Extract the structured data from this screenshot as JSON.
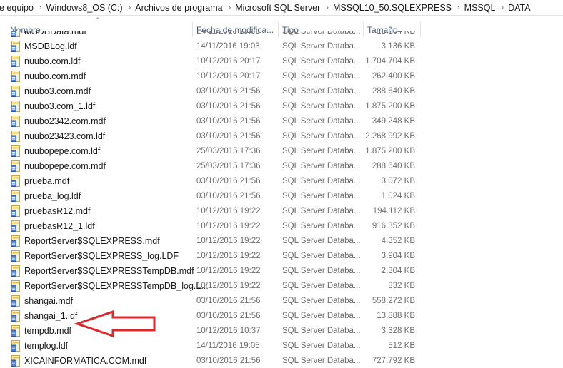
{
  "breadcrumb": [
    "e equipo",
    "Windows8_OS (C:)",
    "Archivos de programa",
    "Microsoft SQL Server",
    "MSSQL10_50.SQLEXPRESS",
    "MSSQL",
    "DATA"
  ],
  "columns": {
    "name": "Nombre",
    "date": "Fecha de modifica...",
    "type": "Tipo",
    "size": "Tamaño"
  },
  "files": [
    {
      "name": "MSDBData.mdf",
      "date": "14/11/2016 19:03",
      "type": "SQL Server Databa...",
      "size": "13.104 KB"
    },
    {
      "name": "MSDBLog.ldf",
      "date": "14/11/2016 19:03",
      "type": "SQL Server Databa...",
      "size": "3.136 KB"
    },
    {
      "name": "nuubo.com.ldf",
      "date": "10/12/2016 20:17",
      "type": "SQL Server Databa...",
      "size": "1.704.704 KB"
    },
    {
      "name": "nuubo.com.mdf",
      "date": "10/12/2016 20:17",
      "type": "SQL Server Databa...",
      "size": "262.400 KB"
    },
    {
      "name": "nuubo3.com.mdf",
      "date": "03/10/2016 21:56",
      "type": "SQL Server Databa...",
      "size": "288.640 KB"
    },
    {
      "name": "nuubo3.com_1.ldf",
      "date": "03/10/2016 21:56",
      "type": "SQL Server Databa...",
      "size": "1.875.200 KB"
    },
    {
      "name": "nuubo2342.com.mdf",
      "date": "03/10/2016 21:56",
      "type": "SQL Server Databa...",
      "size": "349.248 KB"
    },
    {
      "name": "nuubo23423.com.ldf",
      "date": "03/10/2016 21:56",
      "type": "SQL Server Databa...",
      "size": "2.268.992 KB"
    },
    {
      "name": "nuubopepe.com.ldf",
      "date": "25/03/2015 17:36",
      "type": "SQL Server Databa...",
      "size": "1.875.200 KB"
    },
    {
      "name": "nuubopepe.com.mdf",
      "date": "25/03/2015 17:36",
      "type": "SQL Server Databa...",
      "size": "288.640 KB"
    },
    {
      "name": "prueba.mdf",
      "date": "03/10/2016 21:56",
      "type": "SQL Server Databa...",
      "size": "3.072 KB"
    },
    {
      "name": "prueba_log.ldf",
      "date": "03/10/2016 21:56",
      "type": "SQL Server Databa...",
      "size": "1.024 KB"
    },
    {
      "name": "pruebasR12.mdf",
      "date": "10/12/2016 19:22",
      "type": "SQL Server Databa...",
      "size": "194.112 KB"
    },
    {
      "name": "pruebasR12_1.ldf",
      "date": "10/12/2016 19:22",
      "type": "SQL Server Databa...",
      "size": "916.352 KB"
    },
    {
      "name": "ReportServer$SQLEXPRESS.mdf",
      "date": "10/12/2016 19:22",
      "type": "SQL Server Databa...",
      "size": "4.352 KB"
    },
    {
      "name": "ReportServer$SQLEXPRESS_log.LDF",
      "date": "10/12/2016 19:22",
      "type": "SQL Server Databa...",
      "size": "3.904 KB"
    },
    {
      "name": "ReportServer$SQLEXPRESSTempDB.mdf",
      "date": "10/12/2016 19:22",
      "type": "SQL Server Databa...",
      "size": "2.304 KB"
    },
    {
      "name": "ReportServer$SQLEXPRESSTempDB_log.L...",
      "date": "10/12/2016 19:22",
      "type": "SQL Server Databa...",
      "size": "832 KB"
    },
    {
      "name": "shangai.mdf",
      "date": "03/10/2016 21:56",
      "type": "SQL Server Databa...",
      "size": "558.272 KB"
    },
    {
      "name": "shangai_1.ldf",
      "date": "03/10/2016 21:56",
      "type": "SQL Server Databa...",
      "size": "13.888 KB"
    },
    {
      "name": "tempdb.mdf",
      "date": "10/12/2016 10:37",
      "type": "SQL Server Databa...",
      "size": "3.328 KB"
    },
    {
      "name": "templog.ldf",
      "date": "14/11/2016 19:05",
      "type": "SQL Server Databa...",
      "size": "512 KB"
    },
    {
      "name": "XICAINFORMATICA.COM.mdf",
      "date": "03/10/2016 21:56",
      "type": "SQL Server Databa...",
      "size": "727.792 KB"
    }
  ],
  "annotation": {
    "shape": "arrow-left",
    "color": "#e0262a",
    "target_file": "shangai_1.ldf"
  },
  "icons": {
    "file": "database-file-icon"
  }
}
